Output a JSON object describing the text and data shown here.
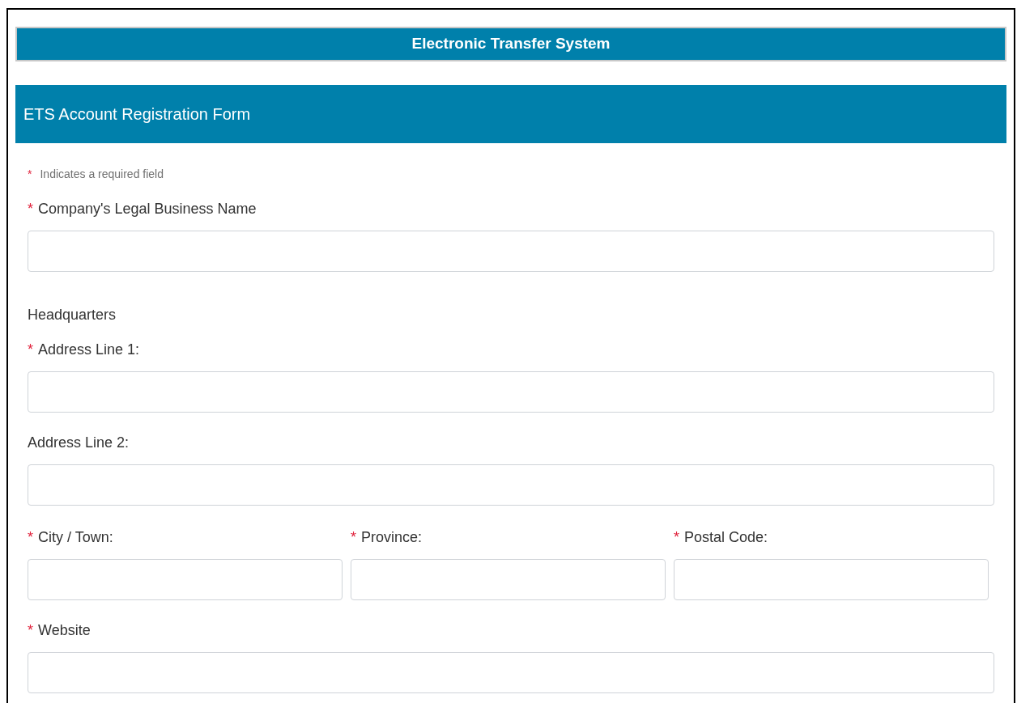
{
  "title": "Electronic Transfer System",
  "form_header": "ETS Account Registration Form",
  "required_note": {
    "mark": "*",
    "text": "Indicates a required field"
  },
  "items": [
    {
      "kind": "field",
      "label": "Company's Legal Business Name",
      "required": true
    },
    {
      "kind": "heading",
      "label": "Headquarters"
    },
    {
      "kind": "field",
      "label": "Address Line 1:",
      "required": true
    },
    {
      "kind": "field",
      "label": "Address Line 2:",
      "required": false
    },
    {
      "kind": "row",
      "fields": [
        {
          "label": "City / Town:",
          "required": true
        },
        {
          "label": "Province:",
          "required": true
        },
        {
          "label": "Postal Code:",
          "required": true
        }
      ]
    },
    {
      "kind": "field",
      "label": "Website",
      "required": true
    }
  ]
}
